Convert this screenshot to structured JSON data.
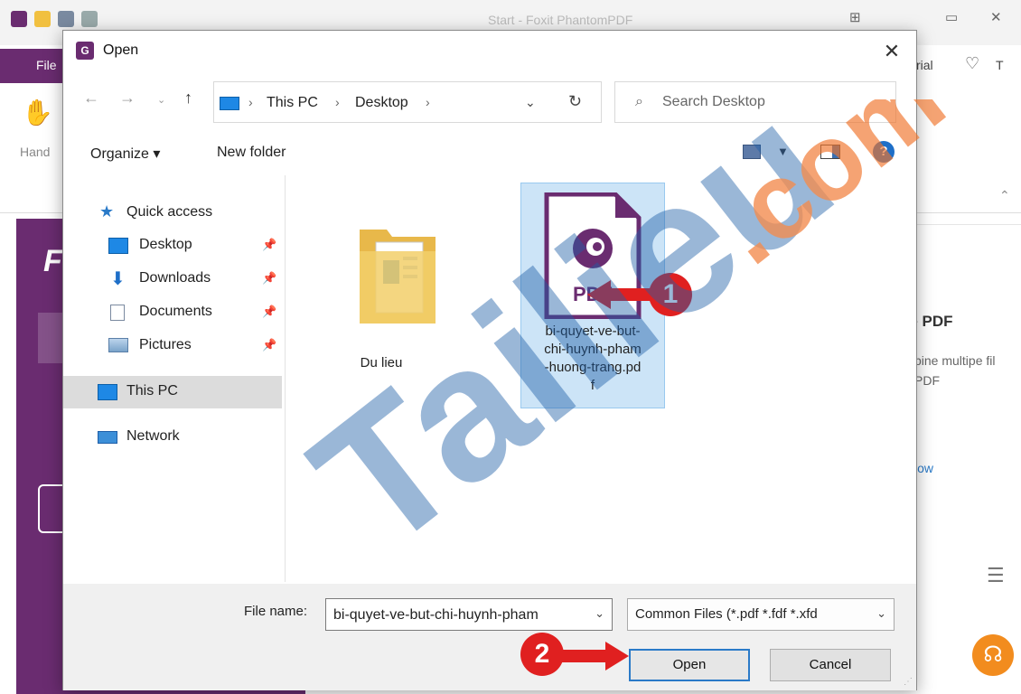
{
  "app": {
    "title": "Start - Foxit PhantomPDF",
    "file_tab": "File",
    "hand_tool_label": "Hand",
    "ribbon_right_text": "rial",
    "ribbon_right_t": "T",
    "card_title": "ge PDF",
    "card_desc_line1": "pine multipe fil",
    "card_desc_line2": "PDF",
    "card_link": "low",
    "purple_logo": "F"
  },
  "dialog": {
    "title": "Open",
    "close_glyph": "✕",
    "address": {
      "segments": [
        "This PC",
        "Desktop"
      ],
      "separator": "›"
    },
    "search": {
      "placeholder": "Search Desktop"
    },
    "toolbar": {
      "organize": "Organize ▾",
      "new_folder": "New folder",
      "help": "?"
    },
    "nav_pane": {
      "quick_access": "Quick access",
      "items": [
        {
          "label": "Desktop",
          "icon": "desktop-icon",
          "pinned": true
        },
        {
          "label": "Downloads",
          "icon": "downloads-icon",
          "pinned": true
        },
        {
          "label": "Documents",
          "icon": "documents-icon",
          "pinned": true
        },
        {
          "label": "Pictures",
          "icon": "pictures-icon",
          "pinned": true
        }
      ],
      "this_pc": "This PC",
      "network": "Network"
    },
    "files": [
      {
        "name": "Du lieu",
        "type": "folder"
      },
      {
        "name": "bi-quyet-ve-but-\nchi-huynh-pham\n-huong-trang.pd\nf",
        "type": "pdf",
        "selected": true,
        "badge": "PDF"
      }
    ],
    "bottom": {
      "file_name_label": "File name:",
      "file_name_value": "bi-quyet-ve-but-chi-huynh-pham",
      "file_type": "Common Files (*.pdf *.fdf *.xfd",
      "open_label": "Open",
      "cancel_label": "Cancel"
    }
  },
  "annotations": {
    "step1": "1",
    "step2": "2"
  },
  "watermark": {
    "text": "Tailieu",
    "suffix": ".com"
  },
  "colors": {
    "brand_purple": "#6a2c70",
    "selection": "#cce4f7",
    "accent_blue": "#2a7ac8",
    "annotation_red": "#e02020",
    "watermark_blue": "#1f5fa8",
    "watermark_orange": "#f0742a"
  }
}
